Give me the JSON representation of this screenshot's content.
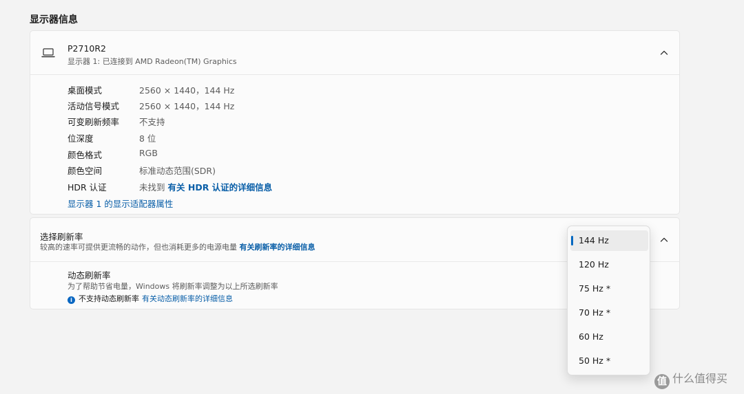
{
  "section_title": "显示器信息",
  "display": {
    "name": "P2710R2",
    "subtitle": "显示器 1: 已连接到 AMD Radeon(TM) Graphics",
    "icon": "laptop-monitor-icon",
    "rows": [
      {
        "label": "桌面模式",
        "value": "2560 × 1440，144 Hz"
      },
      {
        "label": "活动信号模式",
        "value": "2560 × 1440，144 Hz"
      },
      {
        "label": "可变刷新频率",
        "value": "不支持"
      },
      {
        "label": "位深度",
        "value": "8 位"
      },
      {
        "label": "颜色格式",
        "value": "RGB"
      },
      {
        "label": "颜色空间",
        "value": "标准动态范围(SDR)"
      },
      {
        "label": "HDR 认证",
        "value": "未找到",
        "link": "有关 HDR 认证的详细信息"
      }
    ],
    "adapter_link": "显示器 1 的显示适配器属性"
  },
  "refresh": {
    "title": "选择刷新率",
    "subtitle": "较高的速率可提供更流畅的动作，但也消耗更多的电源电量",
    "subtitle_link": "有关刷新率的详细信息",
    "dynamic_title": "动态刷新率",
    "dynamic_subtitle": "为了帮助节省电量，Windows 将刷新率调整为以上所选刷新率",
    "dynamic_note": "不支持动态刷新率",
    "dynamic_link": "有关动态刷新率的详细信息",
    "options": [
      "144 Hz",
      "120 Hz",
      "75 Hz *",
      "70 Hz *",
      "60 Hz",
      "50 Hz *"
    ],
    "selected": "144 Hz"
  },
  "watermark": {
    "text": "什么值得买",
    "icon_glyph": "值"
  },
  "colors": {
    "accent": "#0067c0",
    "link": "#0a5fa8",
    "background": "#f3f3f3",
    "card": "#fbfbfb"
  }
}
